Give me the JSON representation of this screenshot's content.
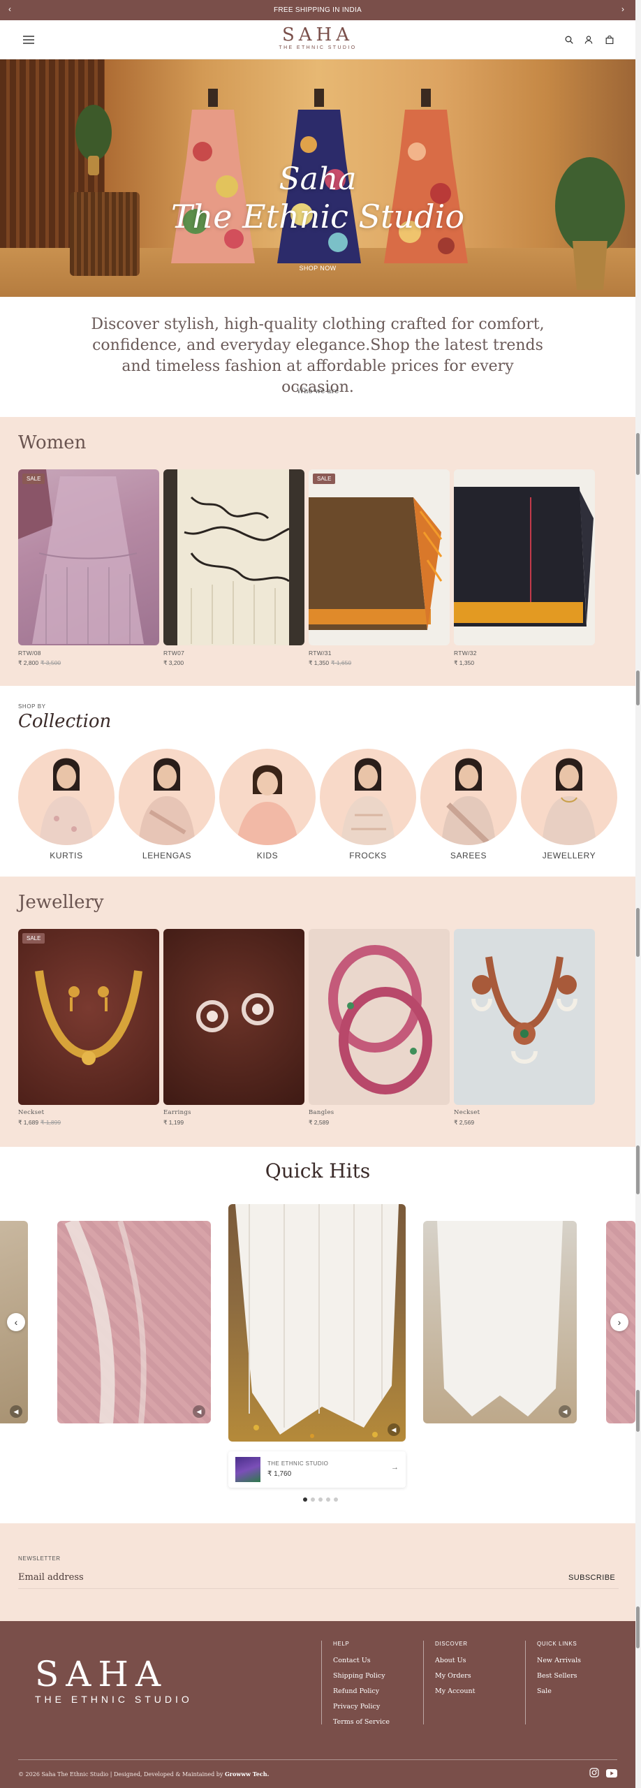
{
  "announcement": {
    "text": "FREE SHIPPING IN INDIA"
  },
  "brand": {
    "name": "SAHA",
    "tagline": "THE ETHNIC STUDIO"
  },
  "hero": {
    "title1": "Saha",
    "title2": "The Ethnic Studio",
    "cta": "SHOP NOW"
  },
  "intro": {
    "text": "Discover stylish, high-quality clothing crafted for comfort, confidence, and everyday elegance.Shop the latest trends and timeless fashion at affordable prices for every occasion.",
    "link": "Who we are"
  },
  "women": {
    "title": "Women",
    "products": [
      {
        "name": "RTW/08",
        "price": "₹ 2,800",
        "compare": "₹ 3,500",
        "sale": "SALE"
      },
      {
        "name": "RTW07",
        "price": "₹ 3,200",
        "compare": "",
        "sale": ""
      },
      {
        "name": "RTW/31",
        "price": "₹ 1,350",
        "compare": "₹ 1,650",
        "sale": "SALE"
      },
      {
        "name": "RTW/32",
        "price": "₹ 1,350",
        "compare": "",
        "sale": ""
      }
    ]
  },
  "collection": {
    "eyebrow": "SHOP BY",
    "title": "Collection",
    "items": [
      "KURTIS",
      "LEHENGAS",
      "KIDS",
      "FROCKS",
      "SAREES",
      "JEWELLERY"
    ]
  },
  "jewellery": {
    "title": "Jewellery",
    "products": [
      {
        "name": "Neckset",
        "price": "₹ 1,689",
        "compare": "₹ 1,899",
        "sale": "SALE"
      },
      {
        "name": "Earrings",
        "price": "₹ 1,199",
        "compare": "",
        "sale": ""
      },
      {
        "name": "Bangles",
        "price": "₹ 2,589",
        "compare": "",
        "sale": ""
      },
      {
        "name": "Neckset",
        "price": "₹ 2,569",
        "compare": "",
        "sale": ""
      }
    ]
  },
  "quick_hits": {
    "title": "Quick Hits",
    "card_vendor": "THE ETHNIC STUDIO",
    "card_price": "₹ 1,760",
    "dots": 5,
    "active_dot": 0
  },
  "newsletter": {
    "eyebrow": "NEWSLETTER",
    "placeholder": "Email address",
    "button": "SUBSCRIBE"
  },
  "footer": {
    "help": {
      "heading": "HELP",
      "links": [
        "Contact Us",
        "Shipping Policy",
        "Refund Policy",
        "Privacy Policy",
        "Terms of Service"
      ]
    },
    "discover": {
      "heading": "DISCOVER",
      "links": [
        "About Us",
        "My Orders",
        "My Account"
      ]
    },
    "quick": {
      "heading": "QUICK LINKS",
      "links": [
        "New Arrivals",
        "Best Sellers",
        "Sale"
      ]
    },
    "copyright": "© 2026 Saha The Ethnic Studio | Designed, Developed & Maintained by",
    "credit": "Growww Tech."
  },
  "colors": {
    "brand": "#7a4f4a",
    "band": "#f7e4d9",
    "circle": "#f8d9c8"
  },
  "icons": [
    "chevron-left-icon",
    "chevron-right-icon",
    "menu-icon",
    "search-icon",
    "user-icon",
    "bag-icon",
    "instagram-icon",
    "youtube-icon",
    "mute-icon",
    "arrow-right-icon"
  ]
}
